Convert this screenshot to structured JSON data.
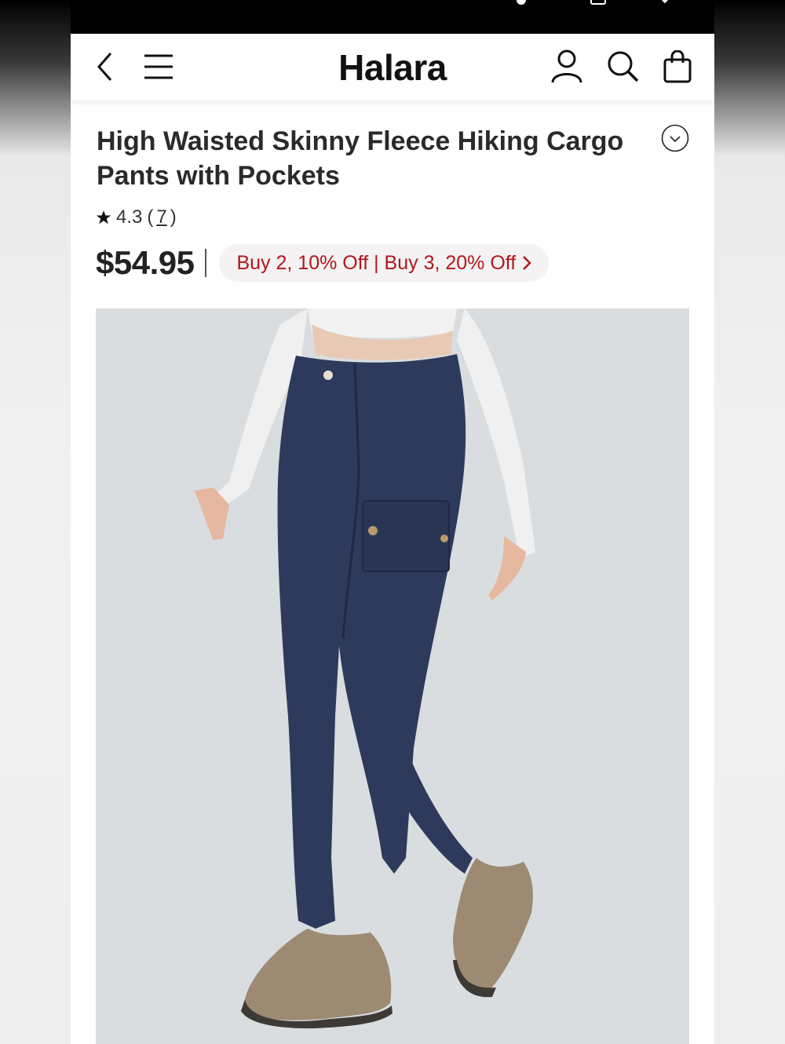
{
  "header": {
    "brand": "Halara",
    "icons": [
      "back-icon",
      "menu-icon",
      "account-icon",
      "search-icon",
      "bag-icon"
    ]
  },
  "product": {
    "title": "High Waisted Skinny Fleece Hiking Cargo Pants with Pockets",
    "rating": "4.3",
    "review_count": "7",
    "price": "$54.95",
    "promo": "Buy 2, 10% Off | Buy 3, 20% Off"
  },
  "colors": {
    "promo_text": "#b3161b",
    "promo_bg": "#f4f2f2",
    "image_bg": "#d9dde0",
    "pants": "#2e3a5c"
  }
}
